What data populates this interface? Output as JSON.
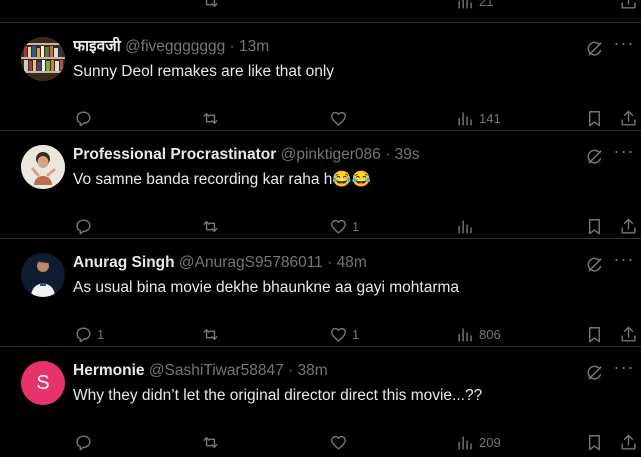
{
  "tweets": [
    {
      "name": "फाइवजी",
      "handle": "@fiveggggggg",
      "time": "13m",
      "text": "Sunny Deol remakes are like that only",
      "replies": "",
      "retweets": "",
      "likes": "",
      "views": "141",
      "avatar_icon": "bookshelf-avatar"
    },
    {
      "name": "Professional Procrastinator",
      "handle": "@pinktiger086",
      "time": "39s",
      "text": "Vo samne banda recording kar raha h😂😂",
      "replies": "",
      "retweets": "",
      "likes": "1",
      "views": "",
      "avatar_icon": "cartoon-avatar"
    },
    {
      "name": "Anurag Singh",
      "handle": "@AnuragS95786011",
      "time": "48m",
      "text": "As usual bina movie dekhe bhaunkne aa gayi mohtarma",
      "replies": "1",
      "retweets": "",
      "likes": "1",
      "views": "806",
      "avatar_icon": "footballer-avatar"
    },
    {
      "name": "Hermonie",
      "handle": "@SashiTiwar58847",
      "time": "38m",
      "text": "Why they didn’t let the original director direct this movie...??",
      "replies": "",
      "retweets": "",
      "likes": "",
      "views": "209",
      "avatar_letter": "S",
      "avatar_color": "#e8336a"
    }
  ],
  "top_fragment": {
    "views": "21"
  },
  "separator": "·",
  "more_glyph": "···",
  "colors": {
    "background": "#000000",
    "text": "#e7e9ea",
    "muted": "#71767b",
    "divider": "#2f3336"
  }
}
